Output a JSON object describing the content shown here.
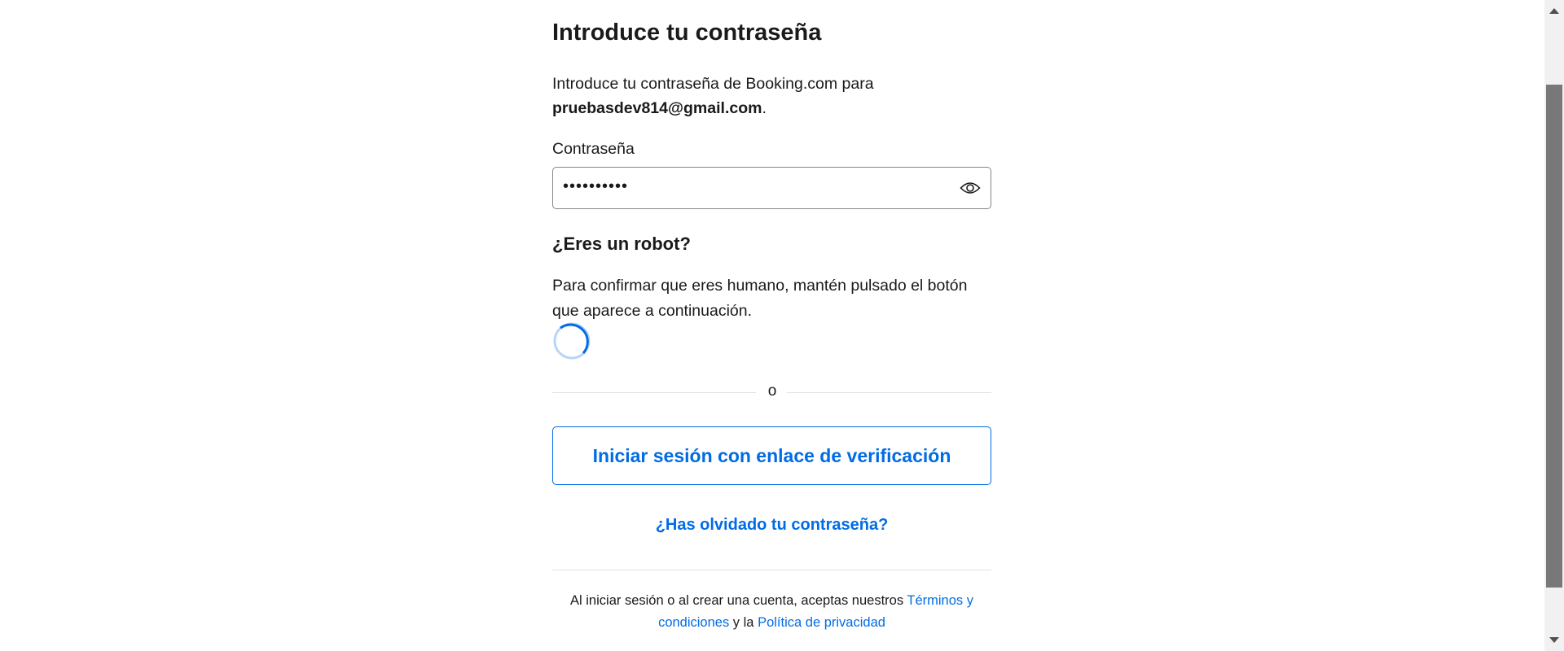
{
  "title": "Introduce tu contraseña",
  "subtitle_prefix": "Introduce tu contraseña de Booking.com para",
  "email": "pruebasdev814@gmail.com",
  "subtitle_suffix": ".",
  "password": {
    "label": "Contraseña",
    "value": "••••••••••",
    "toggle_icon": "eye-icon"
  },
  "robot": {
    "heading": "¿Eres un robot?",
    "text": "Para confirmar que eres humano, mantén pulsado el botón que aparece a continuación."
  },
  "divider_text": "o",
  "verify_link_button": "Iniciar sesión con enlace de verificación",
  "forgot_password": "¿Has olvidado tu contraseña?",
  "footer": {
    "prefix": "Al iniciar sesión o al crear una cuenta, aceptas nuestros",
    "terms": "Términos y condiciones",
    "middle": "y la",
    "privacy": "Política de privacidad"
  },
  "colors": {
    "accent": "#006ce4",
    "text": "#1a1a1a"
  }
}
